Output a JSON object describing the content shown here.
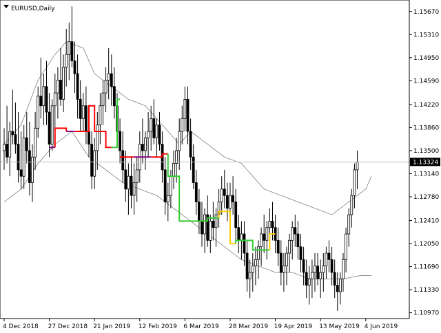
{
  "chart_title": "EURUSD,Daily",
  "colors": {
    "background": "#ffffff",
    "axis": "#000000",
    "grid": "#c0c0c0",
    "candle": "#000000",
    "band": "#808080",
    "trail_red": "#ff0000",
    "trail_green": "#33cc33",
    "trail_purple": "#800080",
    "trail_yellow": "#ffcc00",
    "current_price_line": "#c0c0c0"
  },
  "chart_data": {
    "type": "candlestick",
    "symbol": "EURUSD",
    "timeframe": "Daily",
    "current_price": "1.13324",
    "y_ticks": [
      "1.15670",
      "1.15310",
      "1.14950",
      "1.14590",
      "1.14220",
      "1.13860",
      "1.13500",
      "1.13140",
      "1.12780",
      "1.12410",
      "1.12050",
      "1.11690",
      "1.11330",
      "1.10970"
    ],
    "y_range": [
      1.1088,
      1.1585
    ],
    "x_ticks": [
      "4 Dec 2018",
      "27 Dec 2018",
      "21 Jan 2019",
      "12 Feb 2019",
      "6 Mar 2019",
      "28 Mar 2019",
      "19 Apr 2019",
      "13 May 2019",
      "4 Jun 2019"
    ],
    "x_tick_bar_index": [
      0,
      16,
      32,
      48,
      64,
      80,
      96,
      112,
      128
    ],
    "candles": [
      [
        1.135,
        1.1385,
        1.132,
        1.136
      ],
      [
        1.136,
        1.142,
        1.133,
        1.134
      ],
      [
        1.134,
        1.1395,
        1.131,
        1.138
      ],
      [
        1.138,
        1.1445,
        1.136,
        1.1375
      ],
      [
        1.1375,
        1.1425,
        1.1345,
        1.136
      ],
      [
        1.136,
        1.141,
        1.13,
        1.132
      ],
      [
        1.132,
        1.138,
        1.129,
        1.131
      ],
      [
        1.131,
        1.139,
        1.129,
        1.137
      ],
      [
        1.137,
        1.141,
        1.133,
        1.135
      ],
      [
        1.135,
        1.1395,
        1.128,
        1.13
      ],
      [
        1.13,
        1.136,
        1.127,
        1.134
      ],
      [
        1.134,
        1.141,
        1.132,
        1.1385
      ],
      [
        1.1385,
        1.145,
        1.137,
        1.1435
      ],
      [
        1.1435,
        1.1495,
        1.14,
        1.142
      ],
      [
        1.142,
        1.147,
        1.139,
        1.145
      ],
      [
        1.145,
        1.149,
        1.139,
        1.141
      ],
      [
        1.141,
        1.144,
        1.134,
        1.136
      ],
      [
        1.136,
        1.143,
        1.135,
        1.142
      ],
      [
        1.142,
        1.147,
        1.138,
        1.144
      ],
      [
        1.144,
        1.148,
        1.14,
        1.146
      ],
      [
        1.146,
        1.151,
        1.142,
        1.143
      ],
      [
        1.143,
        1.15,
        1.141,
        1.148
      ],
      [
        1.148,
        1.154,
        1.145,
        1.15
      ],
      [
        1.15,
        1.155,
        1.146,
        1.152
      ],
      [
        1.152,
        1.1575,
        1.148,
        1.149
      ],
      [
        1.149,
        1.152,
        1.144,
        1.147
      ],
      [
        1.147,
        1.15,
        1.14,
        1.143
      ],
      [
        1.143,
        1.146,
        1.138,
        1.14
      ],
      [
        1.14,
        1.144,
        1.138,
        1.142
      ],
      [
        1.142,
        1.145,
        1.136,
        1.138
      ],
      [
        1.138,
        1.142,
        1.134,
        1.136
      ],
      [
        1.136,
        1.138,
        1.129,
        1.131
      ],
      [
        1.131,
        1.137,
        1.129,
        1.135
      ],
      [
        1.135,
        1.141,
        1.132,
        1.139
      ],
      [
        1.139,
        1.144,
        1.136,
        1.142
      ],
      [
        1.142,
        1.146,
        1.139,
        1.144
      ],
      [
        1.144,
        1.148,
        1.141,
        1.146
      ],
      [
        1.146,
        1.151,
        1.143,
        1.147
      ],
      [
        1.147,
        1.15,
        1.142,
        1.145
      ],
      [
        1.145,
        1.148,
        1.14,
        1.142
      ],
      [
        1.142,
        1.144,
        1.137,
        1.138
      ],
      [
        1.138,
        1.14,
        1.133,
        1.135
      ],
      [
        1.135,
        1.138,
        1.13,
        1.132
      ],
      [
        1.132,
        1.135,
        1.127,
        1.129
      ],
      [
        1.129,
        1.133,
        1.125,
        1.131
      ],
      [
        1.131,
        1.134,
        1.126,
        1.128
      ],
      [
        1.128,
        1.133,
        1.125,
        1.13
      ],
      [
        1.13,
        1.134,
        1.127,
        1.132
      ],
      [
        1.132,
        1.138,
        1.13,
        1.136
      ],
      [
        1.136,
        1.14,
        1.133,
        1.135
      ],
      [
        1.135,
        1.138,
        1.132,
        1.137
      ],
      [
        1.137,
        1.141,
        1.134,
        1.138
      ],
      [
        1.138,
        1.142,
        1.135,
        1.14
      ],
      [
        1.14,
        1.143,
        1.136,
        1.137
      ],
      [
        1.137,
        1.14,
        1.134,
        1.139
      ],
      [
        1.139,
        1.141,
        1.135,
        1.136
      ],
      [
        1.136,
        1.138,
        1.13,
        1.132
      ],
      [
        1.132,
        1.134,
        1.125,
        1.127
      ],
      [
        1.127,
        1.13,
        1.124,
        1.128
      ],
      [
        1.128,
        1.132,
        1.126,
        1.131
      ],
      [
        1.131,
        1.135,
        1.129,
        1.133
      ],
      [
        1.133,
        1.137,
        1.13,
        1.135
      ],
      [
        1.135,
        1.14,
        1.132,
        1.138
      ],
      [
        1.138,
        1.142,
        1.136,
        1.14
      ],
      [
        1.14,
        1.145,
        1.138,
        1.143
      ],
      [
        1.143,
        1.145,
        1.136,
        1.138
      ],
      [
        1.138,
        1.14,
        1.132,
        1.134
      ],
      [
        1.134,
        1.136,
        1.129,
        1.13
      ],
      [
        1.13,
        1.132,
        1.125,
        1.127
      ],
      [
        1.127,
        1.129,
        1.122,
        1.124
      ],
      [
        1.124,
        1.127,
        1.12,
        1.122
      ],
      [
        1.122,
        1.126,
        1.119,
        1.125
      ],
      [
        1.125,
        1.128,
        1.12,
        1.121
      ],
      [
        1.121,
        1.125,
        1.119,
        1.124
      ],
      [
        1.124,
        1.127,
        1.121,
        1.123
      ],
      [
        1.123,
        1.126,
        1.12,
        1.125
      ],
      [
        1.125,
        1.129,
        1.123,
        1.127
      ],
      [
        1.127,
        1.131,
        1.125,
        1.129
      ],
      [
        1.129,
        1.132,
        1.126,
        1.128
      ],
      [
        1.128,
        1.13,
        1.124,
        1.126
      ],
      [
        1.126,
        1.13,
        1.123,
        1.128
      ],
      [
        1.128,
        1.131,
        1.125,
        1.127
      ],
      [
        1.127,
        1.129,
        1.121,
        1.123
      ],
      [
        1.123,
        1.125,
        1.119,
        1.121
      ],
      [
        1.121,
        1.124,
        1.118,
        1.122
      ],
      [
        1.122,
        1.124,
        1.117,
        1.119
      ],
      [
        1.119,
        1.121,
        1.113,
        1.115
      ],
      [
        1.115,
        1.118,
        1.112,
        1.116
      ],
      [
        1.116,
        1.119,
        1.113,
        1.117
      ],
      [
        1.117,
        1.12,
        1.114,
        1.118
      ],
      [
        1.118,
        1.121,
        1.115,
        1.12
      ],
      [
        1.12,
        1.123,
        1.117,
        1.122
      ],
      [
        1.122,
        1.125,
        1.119,
        1.121
      ],
      [
        1.121,
        1.124,
        1.118,
        1.123
      ],
      [
        1.123,
        1.126,
        1.12,
        1.124
      ],
      [
        1.124,
        1.127,
        1.121,
        1.123
      ],
      [
        1.123,
        1.125,
        1.119,
        1.121
      ],
      [
        1.121,
        1.123,
        1.117,
        1.119
      ],
      [
        1.119,
        1.121,
        1.114,
        1.116
      ],
      [
        1.116,
        1.119,
        1.113,
        1.117
      ],
      [
        1.117,
        1.12,
        1.114,
        1.119
      ],
      [
        1.119,
        1.122,
        1.116,
        1.121
      ],
      [
        1.121,
        1.124,
        1.118,
        1.123
      ],
      [
        1.123,
        1.125,
        1.12,
        1.122
      ],
      [
        1.122,
        1.124,
        1.118,
        1.12
      ],
      [
        1.12,
        1.122,
        1.116,
        1.118
      ],
      [
        1.118,
        1.12,
        1.114,
        1.116
      ],
      [
        1.116,
        1.118,
        1.112,
        1.114
      ],
      [
        1.114,
        1.117,
        1.111,
        1.115
      ],
      [
        1.115,
        1.118,
        1.112,
        1.116
      ],
      [
        1.116,
        1.119,
        1.113,
        1.117
      ],
      [
        1.117,
        1.119,
        1.114,
        1.115
      ],
      [
        1.115,
        1.118,
        1.112,
        1.116
      ],
      [
        1.116,
        1.119,
        1.113,
        1.117
      ],
      [
        1.117,
        1.12,
        1.115,
        1.119
      ],
      [
        1.119,
        1.121,
        1.116,
        1.118
      ],
      [
        1.118,
        1.12,
        1.114,
        1.116
      ],
      [
        1.116,
        1.118,
        1.112,
        1.114
      ],
      [
        1.114,
        1.116,
        1.11,
        1.113
      ],
      [
        1.113,
        1.116,
        1.111,
        1.115
      ],
      [
        1.115,
        1.119,
        1.113,
        1.118
      ],
      [
        1.118,
        1.123,
        1.116,
        1.122
      ],
      [
        1.122,
        1.126,
        1.12,
        1.125
      ],
      [
        1.125,
        1.129,
        1.123,
        1.128
      ],
      [
        1.128,
        1.133,
        1.126,
        1.132
      ],
      [
        1.132,
        1.135,
        1.129,
        1.1332
      ]
    ],
    "band_upper": [
      [
        0,
        1.136
      ],
      [
        6,
        1.139
      ],
      [
        12,
        1.146
      ],
      [
        18,
        1.15
      ],
      [
        22,
        1.152
      ],
      [
        28,
        1.151
      ],
      [
        32,
        1.147
      ],
      [
        38,
        1.145
      ],
      [
        44,
        1.143
      ],
      [
        50,
        1.142
      ],
      [
        56,
        1.139
      ],
      [
        62,
        1.136
      ],
      [
        66,
        1.138
      ],
      [
        72,
        1.136
      ],
      [
        78,
        1.134
      ],
      [
        84,
        1.133
      ],
      [
        88,
        1.131
      ],
      [
        92,
        1.129
      ],
      [
        98,
        1.128
      ],
      [
        104,
        1.127
      ],
      [
        110,
        1.126
      ],
      [
        116,
        1.125
      ],
      [
        122,
        1.127
      ],
      [
        128,
        1.129
      ],
      [
        130,
        1.131
      ]
    ],
    "band_lower": [
      [
        0,
        1.127
      ],
      [
        6,
        1.129
      ],
      [
        12,
        1.133
      ],
      [
        18,
        1.136
      ],
      [
        24,
        1.138
      ],
      [
        30,
        1.134
      ],
      [
        36,
        1.132
      ],
      [
        42,
        1.13
      ],
      [
        48,
        1.129
      ],
      [
        54,
        1.128
      ],
      [
        60,
        1.126
      ],
      [
        66,
        1.124
      ],
      [
        72,
        1.122
      ],
      [
        78,
        1.12
      ],
      [
        84,
        1.118
      ],
      [
        90,
        1.117
      ],
      [
        96,
        1.116
      ],
      [
        102,
        1.116
      ],
      [
        108,
        1.115
      ],
      [
        114,
        1.115
      ],
      [
        120,
        1.115
      ],
      [
        126,
        1.1155
      ],
      [
        130,
        1.1155
      ]
    ],
    "trail_segments": [
      {
        "color": "purple",
        "points": [
          [
            16,
            1.1355
          ],
          [
            18,
            1.1355
          ]
        ]
      },
      {
        "color": "red",
        "points": [
          [
            18,
            1.1355
          ],
          [
            18,
            1.1385
          ],
          [
            22,
            1.1385
          ],
          [
            22,
            1.138
          ]
        ]
      },
      {
        "color": "purple",
        "points": [
          [
            22,
            1.138
          ],
          [
            25,
            1.138
          ]
        ]
      },
      {
        "color": "red",
        "points": [
          [
            25,
            1.138
          ],
          [
            30,
            1.138
          ],
          [
            30,
            1.142
          ],
          [
            32,
            1.142
          ],
          [
            32,
            1.138
          ],
          [
            36,
            1.138
          ],
          [
            36,
            1.1355
          ],
          [
            38,
            1.1355
          ]
        ]
      },
      {
        "color": "green",
        "points": [
          [
            38,
            1.1355
          ],
          [
            40,
            1.1355
          ],
          [
            40,
            1.143
          ],
          [
            41,
            1.143
          ]
        ]
      },
      {
        "color": "red",
        "points": [
          [
            41,
            1.134
          ],
          [
            46,
            1.134
          ]
        ]
      },
      {
        "color": "purple",
        "points": [
          [
            46,
            1.134
          ],
          [
            52,
            1.134
          ]
        ]
      },
      {
        "color": "red",
        "points": [
          [
            52,
            1.134
          ],
          [
            56,
            1.134
          ],
          [
            56,
            1.1345
          ],
          [
            58,
            1.1345
          ]
        ]
      },
      {
        "color": "green",
        "points": [
          [
            58,
            1.1345
          ],
          [
            58,
            1.131
          ],
          [
            62,
            1.131
          ],
          [
            62,
            1.124
          ],
          [
            72,
            1.124
          ],
          [
            72,
            1.1245
          ],
          [
            76,
            1.1245
          ]
        ]
      },
      {
        "color": "yellow",
        "points": [
          [
            76,
            1.1245
          ],
          [
            76,
            1.1255
          ],
          [
            80,
            1.1255
          ],
          [
            80,
            1.1205
          ],
          [
            82,
            1.1205
          ]
        ]
      },
      {
        "color": "green",
        "points": [
          [
            82,
            1.1205
          ],
          [
            82,
            1.121
          ],
          [
            88,
            1.121
          ],
          [
            88,
            1.1195
          ],
          [
            94,
            1.1195
          ]
        ]
      },
      {
        "color": "yellow",
        "points": [
          [
            94,
            1.1195
          ],
          [
            94,
            1.122
          ],
          [
            96,
            1.122
          ]
        ]
      }
    ]
  }
}
